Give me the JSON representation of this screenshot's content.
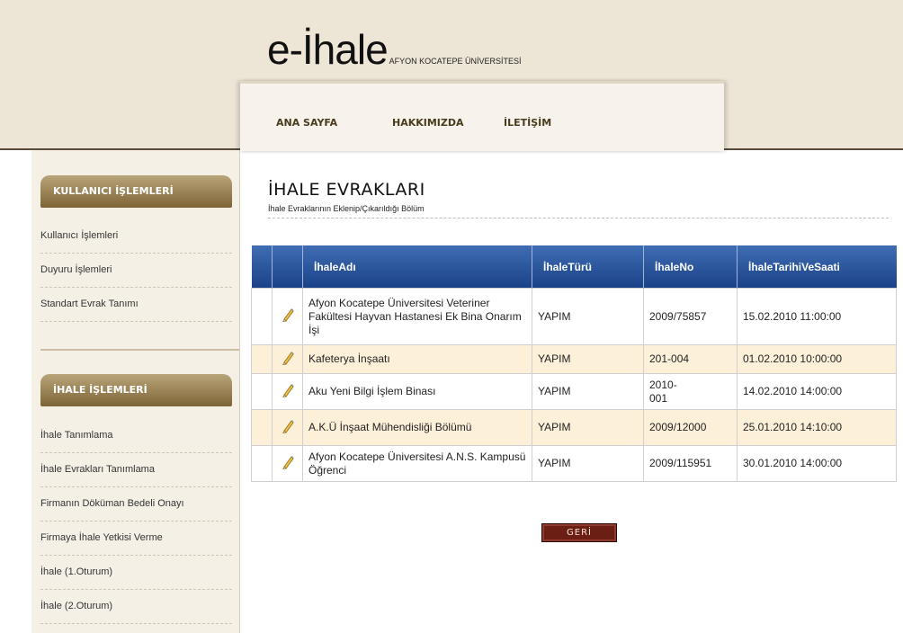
{
  "header": {
    "brand": "e-İhale",
    "university": "AFYON KOCATEPE ÜNİVERSİTESİ",
    "nav": [
      {
        "label": "ANA SAYFA"
      },
      {
        "label": "HAKKIMIZDA"
      },
      {
        "label": "İLETİŞİM"
      }
    ]
  },
  "sidebar": {
    "user_section": {
      "title": "KULLANICI İŞLEMLERİ",
      "items": [
        "Kullanıcı İşlemleri",
        "Duyuru İşlemleri",
        "Standart Evrak Tanımı"
      ]
    },
    "tender_section": {
      "title": "İHALE İŞLEMLERİ",
      "items": [
        "İhale Tanımlama",
        "İhale Evrakları Tanımlama",
        "Firmanın Döküman Bedeli Onayı",
        "Firmaya İhale Yetkisi Verme",
        "İhale (1.Oturum)",
        "İhale (2.Oturum)"
      ]
    }
  },
  "main": {
    "title": "İHALE EVRAKLARI",
    "subtitle": "İhale Evraklarının Eklenip/Çıkarıldığı Bölüm",
    "columns": [
      "İhaleAdı",
      "İhaleTürü",
      "İhaleNo",
      "İhaleTarihiVeSaati"
    ],
    "rows": [
      {
        "name": "Afyon Kocatepe Üniversitesi Veteriner Fakültesi Hayvan Hastanesi Ek Bina Onarım İşi",
        "type": "YAPIM",
        "no": "2009/75857",
        "date": "15.02.2010 11:00:00"
      },
      {
        "name": "Kafeterya İnşaatı",
        "type": "YAPIM",
        "no": "201-004",
        "date": "01.02.2010 10:00:00"
      },
      {
        "name": "Aku Yeni Bilgi İşlem Binası",
        "type": "YAPIM",
        "no": "2010-001",
        "date": "14.02.2010 14:00:00"
      },
      {
        "name": "A.K.Ü İnşaat Mühendisliği Bölümü",
        "type": "YAPIM",
        "no": "2009/12000",
        "date": "25.01.2010 14:10:00"
      },
      {
        "name": "Afyon Kocatepe Üniversitesi A.N.S. Kampusü Öğrenci",
        "type": "YAPIM",
        "no": "2009/115951",
        "date": "30.01.2010 14:00:00"
      }
    ],
    "back_button": "GERİ",
    "edit_icon": "pencil-icon"
  },
  "colors": {
    "header_bg": "#ede5d6",
    "sidebar_head": "#7d6436",
    "table_head": "#1b4288",
    "row_alt": "#fdf0d9",
    "button": "#6b1e14"
  }
}
